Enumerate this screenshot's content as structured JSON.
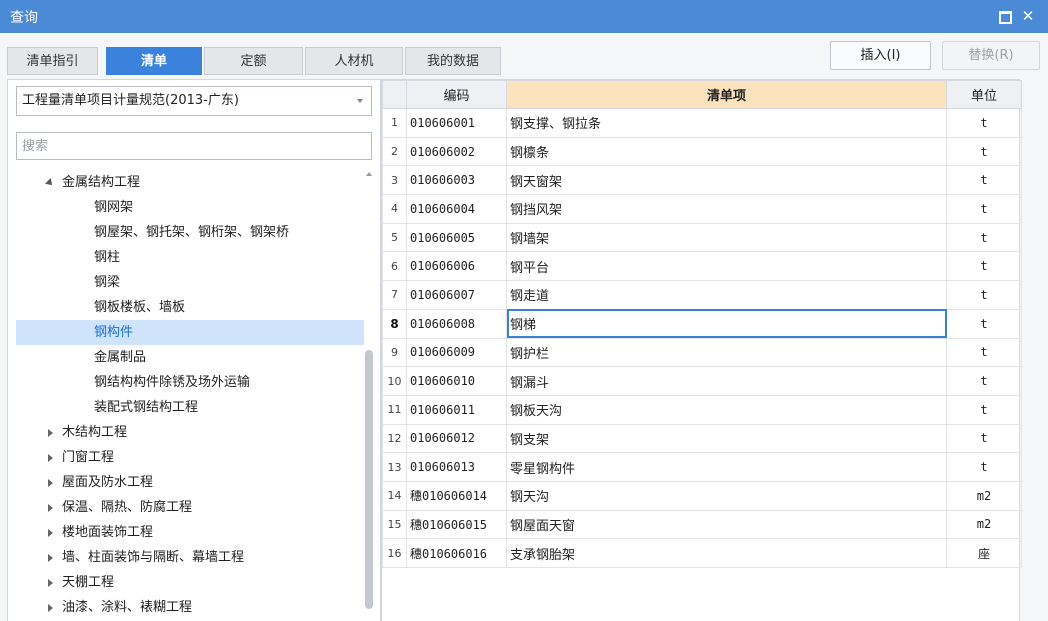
{
  "window": {
    "title": "查询"
  },
  "tabs": [
    {
      "label": "清单指引",
      "active": false
    },
    {
      "label": "清单",
      "active": true
    },
    {
      "label": "定额",
      "active": false
    },
    {
      "label": "人材机",
      "active": false
    },
    {
      "label": "我的数据",
      "active": false
    }
  ],
  "actions": {
    "insert_label": "插入(I)",
    "replace_label": "替换(R)"
  },
  "left": {
    "spec_select": "工程量清单项目计量规范(2013-广东)",
    "search_placeholder": "搜索",
    "tree": [
      {
        "label": "金属结构工程",
        "level": 0,
        "expander": "expanded"
      },
      {
        "label": "钢网架",
        "level": 1
      },
      {
        "label": "钢屋架、钢托架、钢桁架、钢架桥",
        "level": 1
      },
      {
        "label": "钢柱",
        "level": 1
      },
      {
        "label": "钢梁",
        "level": 1
      },
      {
        "label": "钢板楼板、墙板",
        "level": 1
      },
      {
        "label": "钢构件",
        "level": 1,
        "selected": true
      },
      {
        "label": "金属制品",
        "level": 1
      },
      {
        "label": "钢结构构件除锈及场外运输",
        "level": 1
      },
      {
        "label": "装配式钢结构工程",
        "level": 1
      },
      {
        "label": "木结构工程",
        "level": 0,
        "expander": "collapsed"
      },
      {
        "label": "门窗工程",
        "level": 0,
        "expander": "collapsed"
      },
      {
        "label": "屋面及防水工程",
        "level": 0,
        "expander": "collapsed"
      },
      {
        "label": "保温、隔热、防腐工程",
        "level": 0,
        "expander": "collapsed"
      },
      {
        "label": "楼地面装饰工程",
        "level": 0,
        "expander": "collapsed"
      },
      {
        "label": "墙、柱面装饰与隔断、幕墙工程",
        "level": 0,
        "expander": "collapsed"
      },
      {
        "label": "天棚工程",
        "level": 0,
        "expander": "collapsed"
      },
      {
        "label": "油漆、涂料、裱糊工程",
        "level": 0,
        "expander": "collapsed"
      }
    ]
  },
  "table": {
    "headers": {
      "code": "编码",
      "item": "清单项",
      "unit": "单位"
    },
    "current_row": 8,
    "rows": [
      {
        "no": "1",
        "code": "010606001",
        "name": "钢支撑、钢拉条",
        "unit": "t"
      },
      {
        "no": "2",
        "code": "010606002",
        "name": "钢檩条",
        "unit": "t"
      },
      {
        "no": "3",
        "code": "010606003",
        "name": "钢天窗架",
        "unit": "t"
      },
      {
        "no": "4",
        "code": "010606004",
        "name": "钢挡风架",
        "unit": "t"
      },
      {
        "no": "5",
        "code": "010606005",
        "name": "钢墙架",
        "unit": "t"
      },
      {
        "no": "6",
        "code": "010606006",
        "name": "钢平台",
        "unit": "t"
      },
      {
        "no": "7",
        "code": "010606007",
        "name": "钢走道",
        "unit": "t"
      },
      {
        "no": "8",
        "code": "010606008",
        "name": "钢梯",
        "unit": "t"
      },
      {
        "no": "9",
        "code": "010606009",
        "name": "钢护栏",
        "unit": "t"
      },
      {
        "no": "10",
        "code": "010606010",
        "name": "钢漏斗",
        "unit": "t"
      },
      {
        "no": "11",
        "code": "010606011",
        "name": "钢板天沟",
        "unit": "t"
      },
      {
        "no": "12",
        "code": "010606012",
        "name": "钢支架",
        "unit": "t"
      },
      {
        "no": "13",
        "code": "010606013",
        "name": "零星钢构件",
        "unit": "t"
      },
      {
        "no": "14",
        "code": "穗010606014",
        "name": "钢天沟",
        "unit": "m2"
      },
      {
        "no": "15",
        "code": "穗010606015",
        "name": "钢屋面天窗",
        "unit": "m2"
      },
      {
        "no": "16",
        "code": "穗010606016",
        "name": "支承钢胎架",
        "unit": "座"
      }
    ]
  },
  "colors": {
    "titlebar": "#4a8ad7",
    "active_tab": "#3b82dc",
    "selection": "#cfe3fb",
    "header_highlight": "#fbe3bd"
  }
}
